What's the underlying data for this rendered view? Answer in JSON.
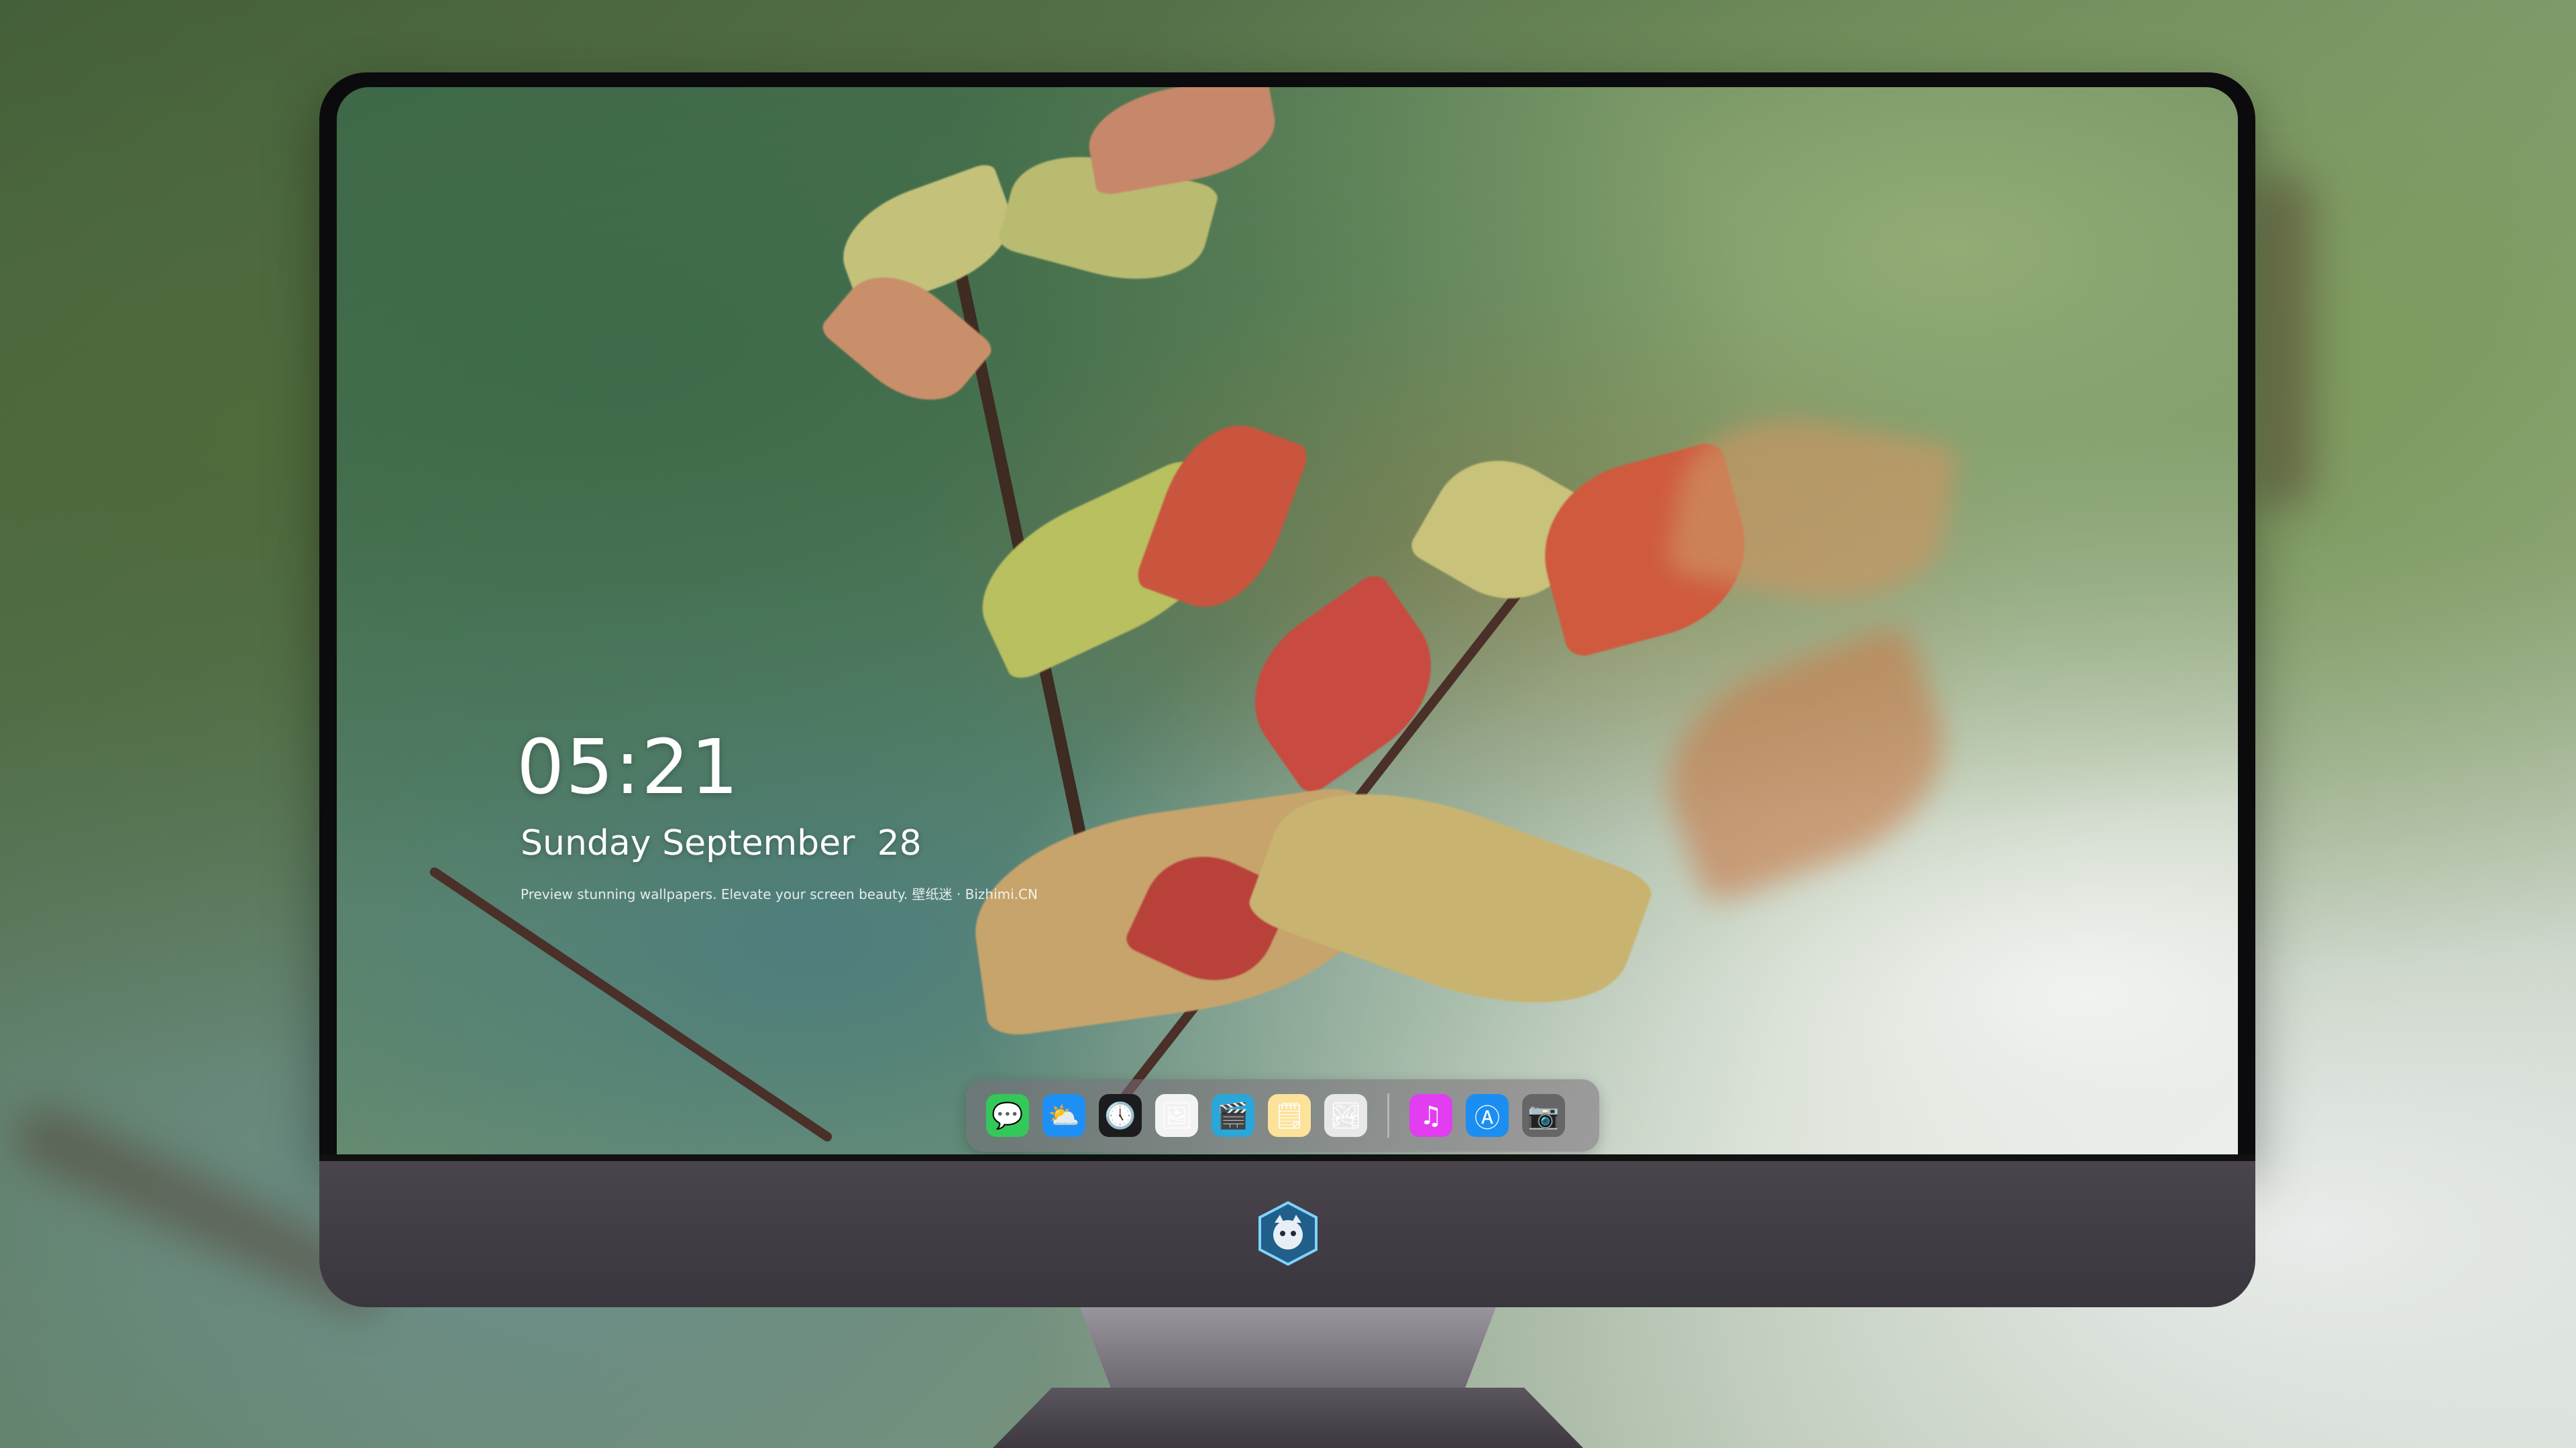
{
  "lockscreen": {
    "time": "05:21",
    "date": "Sunday September  28",
    "tagline": "Preview stunning wallpapers. Elevate your screen beauty. 壁纸迷 · Bizhimi.CN"
  },
  "dock": {
    "items": [
      {
        "name": "messages-icon",
        "glyph": "💬",
        "color": "#34c759"
      },
      {
        "name": "weather-icon",
        "glyph": "⛅",
        "color": "#1e8ff5"
      },
      {
        "name": "clock-icon",
        "glyph": "🕔",
        "color": "#1c1c1e"
      },
      {
        "name": "preview-icon",
        "glyph": "🖼",
        "color": "#f3f3f3"
      },
      {
        "name": "video-clapper-icon",
        "glyph": "🎬",
        "color": "#2aa6d8"
      },
      {
        "name": "notes-icon",
        "glyph": "🗒",
        "color": "#fde29a"
      },
      {
        "name": "photo-booth-icon",
        "glyph": "🏞",
        "color": "#e8e8e8"
      }
    ],
    "right_items": [
      {
        "name": "itunes-music-icon",
        "glyph": "♫",
        "color": "#e23df0"
      },
      {
        "name": "app-store-icon",
        "glyph": "Ⓐ",
        "color": "#1b8ef2"
      },
      {
        "name": "camera-icon",
        "glyph": "📷",
        "color": "#666666"
      }
    ]
  },
  "colors": {
    "chin": "#3f3a42",
    "bezel": "#0b0b0d"
  }
}
